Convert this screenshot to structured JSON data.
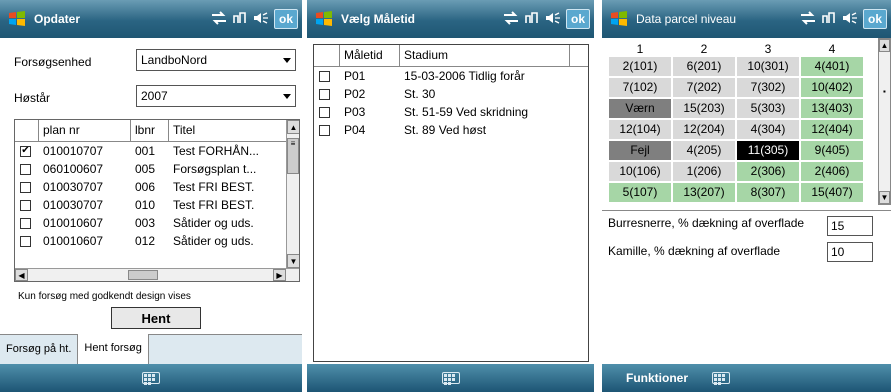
{
  "screen1": {
    "title": "Opdater",
    "ok": "ok",
    "label_forsogsenhed": "Forsøgsenhed",
    "value_forsogsenhed": "LandboNord",
    "label_hostar": "Høstår",
    "value_hostar": "2007",
    "columns": [
      "plan nr",
      "lbnr",
      "Titel"
    ],
    "rows": [
      {
        "checked": true,
        "plan": "010010707",
        "lbnr": "001",
        "titel": "Test FORHÅN..."
      },
      {
        "checked": false,
        "plan": "060100607",
        "lbnr": "005",
        "titel": "Forsøgsplan t..."
      },
      {
        "checked": false,
        "plan": "010030707",
        "lbnr": "006",
        "titel": "Test FRI BEST."
      },
      {
        "checked": false,
        "plan": "010030707",
        "lbnr": "010",
        "titel": "Test FRI BEST."
      },
      {
        "checked": false,
        "plan": "010010607",
        "lbnr": "003",
        "titel": "Såtider og uds."
      },
      {
        "checked": false,
        "plan": "010010607",
        "lbnr": "012",
        "titel": "Såtider og uds."
      }
    ],
    "note": "Kun forsøg med godkendt design vises",
    "hent_button": "Hent",
    "tabs": [
      "Forsøg på ht.",
      "Hent forsøg"
    ]
  },
  "screen2": {
    "title": "Vælg Måletid",
    "ok": "ok",
    "columns": [
      "Måletid",
      "Stadium"
    ],
    "rows": [
      {
        "maletid": "P01",
        "stadium": "15-03-2006 Tidlig forår"
      },
      {
        "maletid": "P02",
        "stadium": "St. 30"
      },
      {
        "maletid": "P03",
        "stadium": "St. 51-59 Ved skridning"
      },
      {
        "maletid": "P04",
        "stadium": "St. 89 Ved høst"
      }
    ]
  },
  "screen3": {
    "title": "Data parcel niveau",
    "ok": "ok",
    "col_headers": [
      "1",
      "2",
      "3",
      "4"
    ],
    "cells": [
      [
        "2(101)",
        "6(201)",
        "10(301)",
        "4(401)"
      ],
      [
        "7(102)",
        "7(202)",
        "7(302)",
        "10(402)"
      ],
      [
        "Værn",
        "15(203)",
        "5(303)",
        "13(403)"
      ],
      [
        "12(104)",
        "12(204)",
        "4(304)",
        "12(404)"
      ],
      [
        "Fejl",
        "4(205)",
        "11(305)",
        "9(405)"
      ],
      [
        "10(106)",
        "1(206)",
        "2(306)",
        "2(406)"
      ],
      [
        "5(107)",
        "13(207)",
        "8(307)",
        "15(407)"
      ]
    ],
    "cell_styles": [
      [
        "grey",
        "grey",
        "grey",
        "green"
      ],
      [
        "grey",
        "grey",
        "grey",
        "green"
      ],
      [
        "dark",
        "grey",
        "grey",
        "green"
      ],
      [
        "grey",
        "grey",
        "grey",
        "green"
      ],
      [
        "dark",
        "grey",
        "black",
        "green"
      ],
      [
        "grey",
        "grey",
        "green",
        "green"
      ],
      [
        "green",
        "green",
        "green",
        "green"
      ]
    ],
    "label_burresnerre": "Burresnerre, % dækning af overflade",
    "value_burresnerre": "15",
    "label_kamille": "Kamille, % dækning af overflade",
    "value_kamille": "10",
    "menu_funktioner": "Funktioner"
  },
  "colors": {
    "titlebar": "#2a6482",
    "cell_grey": "#d9d9d9",
    "cell_green": "#a6d6a6",
    "cell_dark": "#7f7f7f",
    "cell_selected": "#000000"
  }
}
